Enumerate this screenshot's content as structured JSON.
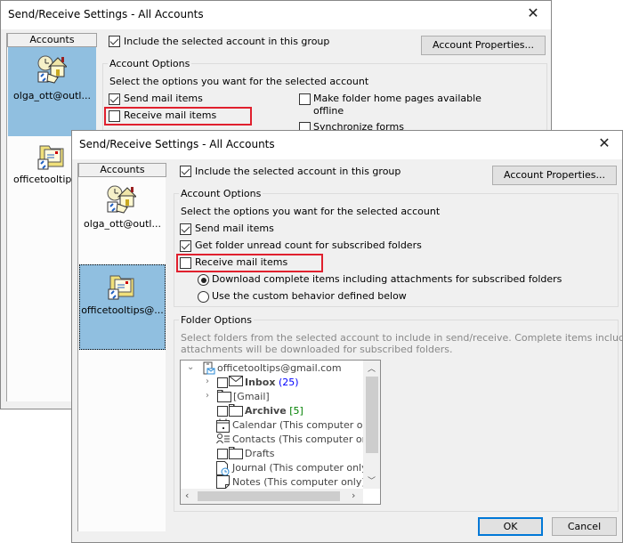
{
  "back_dialog": {
    "title": "Send/Receive Settings - All Accounts",
    "accounts_header": "Accounts",
    "accounts": [
      {
        "label": "olga_ott@outl...",
        "icon": "account-house-icon",
        "selected": true
      },
      {
        "label": "officetooltips",
        "icon": "account-folder-icon",
        "selected": false
      }
    ],
    "include_label": "Include the selected account in this group",
    "include_checked": true,
    "account_properties_label": "Account Properties...",
    "account_options_legend": "Account Options",
    "options_prompt": "Select the options you want for the selected account",
    "send_mail_label": "Send mail items",
    "send_mail_checked": true,
    "receive_mail_label": "Receive mail items",
    "receive_mail_checked": false,
    "make_folder_label_1": "Make folder home pages available",
    "make_folder_label_2": "offline",
    "make_folder_checked": false,
    "sync_forms_label": "Synchronize forms",
    "sync_forms_checked": false
  },
  "front_dialog": {
    "title": "Send/Receive Settings - All Accounts",
    "accounts_header": "Accounts",
    "accounts": [
      {
        "label": "olga_ott@outl...",
        "icon": "account-house-icon",
        "selected": false
      },
      {
        "label": "officetooltips@...",
        "icon": "account-folder-icon",
        "selected": true
      }
    ],
    "include_label": "Include the selected account in this group",
    "include_checked": true,
    "account_properties_label": "Account Properties...",
    "account_options_legend": "Account Options",
    "options_prompt": "Select the options you want for the selected account",
    "send_mail_label": "Send mail items",
    "send_mail_checked": true,
    "unread_count_label": "Get folder unread count for subscribed folders",
    "unread_count_checked": true,
    "receive_mail_label": "Receive mail items",
    "receive_mail_checked": false,
    "radio_download_label": "Download complete items including attachments for subscribed folders",
    "radio_download_selected": true,
    "radio_custom_label": "Use the custom behavior defined below",
    "radio_custom_selected": false,
    "folder_options_legend": "Folder Options",
    "folder_desc_1": "Select folders from the selected account to include in send/receive. Complete items including",
    "folder_desc_2": "attachments will be downloaded for subscribed folders.",
    "tree": {
      "root": "officetooltips@gmail.com",
      "items": [
        {
          "label": "Inbox",
          "count": "(25)",
          "count_color": "#0000ff",
          "bold": true,
          "icon": "mail-icon",
          "checkbox": true,
          "expander": true
        },
        {
          "label": "[Gmail]",
          "count": "",
          "bold": false,
          "icon": "folder-icon",
          "checkbox": false,
          "expander": true
        },
        {
          "label": "Archive",
          "count": "[5]",
          "count_color": "#008000",
          "bold": true,
          "icon": "folder-icon",
          "checkbox": true,
          "expander": false
        },
        {
          "label": "Calendar (This computer on",
          "count": "",
          "bold": false,
          "icon": "calendar-icon",
          "checkbox": false,
          "expander": false
        },
        {
          "label": "Contacts (This computer on",
          "count": "",
          "bold": false,
          "icon": "contacts-icon",
          "checkbox": false,
          "expander": false
        },
        {
          "label": "Drafts",
          "count": "",
          "bold": false,
          "icon": "folder-icon",
          "checkbox": true,
          "expander": false
        },
        {
          "label": "Journal (This computer only",
          "count": "",
          "bold": false,
          "icon": "journal-icon",
          "checkbox": false,
          "expander": false
        },
        {
          "label": "Notes (This computer only)",
          "count": "",
          "bold": false,
          "icon": "notes-icon",
          "checkbox": false,
          "expander": false
        }
      ]
    },
    "ok_label": "OK",
    "cancel_label": "Cancel"
  },
  "colors": {
    "highlight_box": "#e0202e",
    "selection": "#90bfe0",
    "default_button_border": "#0078d7"
  }
}
